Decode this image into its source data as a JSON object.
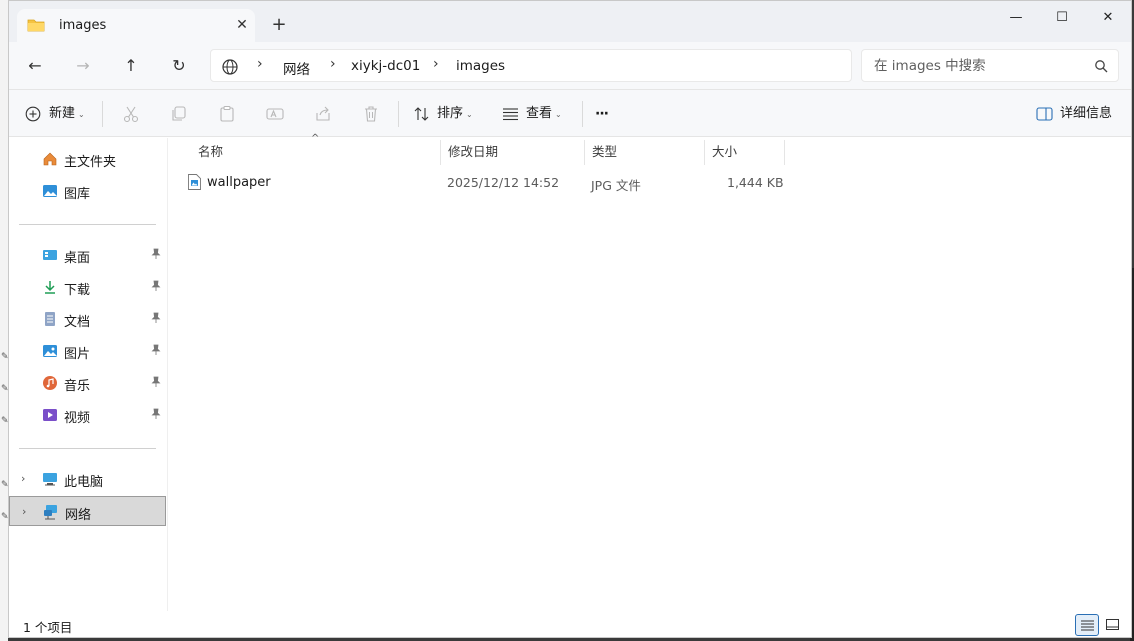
{
  "window": {
    "tab_title": "images",
    "tab_close": "✕",
    "new_tab": "+"
  },
  "window_controls": {
    "minimize": "—",
    "maximize": "☐",
    "close": "✕"
  },
  "nav": {
    "back": "←",
    "forward": "→",
    "up": "↑",
    "refresh": "↻"
  },
  "breadcrumb": {
    "items": [
      "网络",
      "xiykj-dc01",
      "images"
    ],
    "separator": "›"
  },
  "search": {
    "placeholder": "在 images 中搜索"
  },
  "toolbar": {
    "new_label": "新建",
    "sort_label": "排序",
    "view_label": "查看",
    "more_label": "···",
    "details_label": "详细信息"
  },
  "sidebar": {
    "quick": [
      {
        "label": "主文件夹",
        "icon": "home-icon"
      },
      {
        "label": "图库",
        "icon": "gallery-icon"
      }
    ],
    "pinned": [
      {
        "label": "桌面",
        "icon": "desktop-icon"
      },
      {
        "label": "下载",
        "icon": "download-icon"
      },
      {
        "label": "文档",
        "icon": "documents-icon"
      },
      {
        "label": "图片",
        "icon": "pictures-icon"
      },
      {
        "label": "音乐",
        "icon": "music-icon"
      },
      {
        "label": "视频",
        "icon": "videos-icon"
      }
    ],
    "locations": [
      {
        "label": "此电脑",
        "icon": "computer-icon",
        "expand": "›"
      },
      {
        "label": "网络",
        "icon": "network-icon",
        "expand": "›",
        "selected": true
      }
    ]
  },
  "columns": {
    "name": "名称",
    "modified": "修改日期",
    "type": "类型",
    "size": "大小"
  },
  "files": [
    {
      "name": "wallpaper",
      "modified": "2025/12/12 14:52",
      "type": "JPG 文件",
      "size": "1,444 KB"
    }
  ],
  "status": {
    "count_text": "1 个项目"
  },
  "colors": {
    "accent": "#2a6fb5",
    "folder": "#f5c342",
    "selection": "#d9d9d9"
  }
}
